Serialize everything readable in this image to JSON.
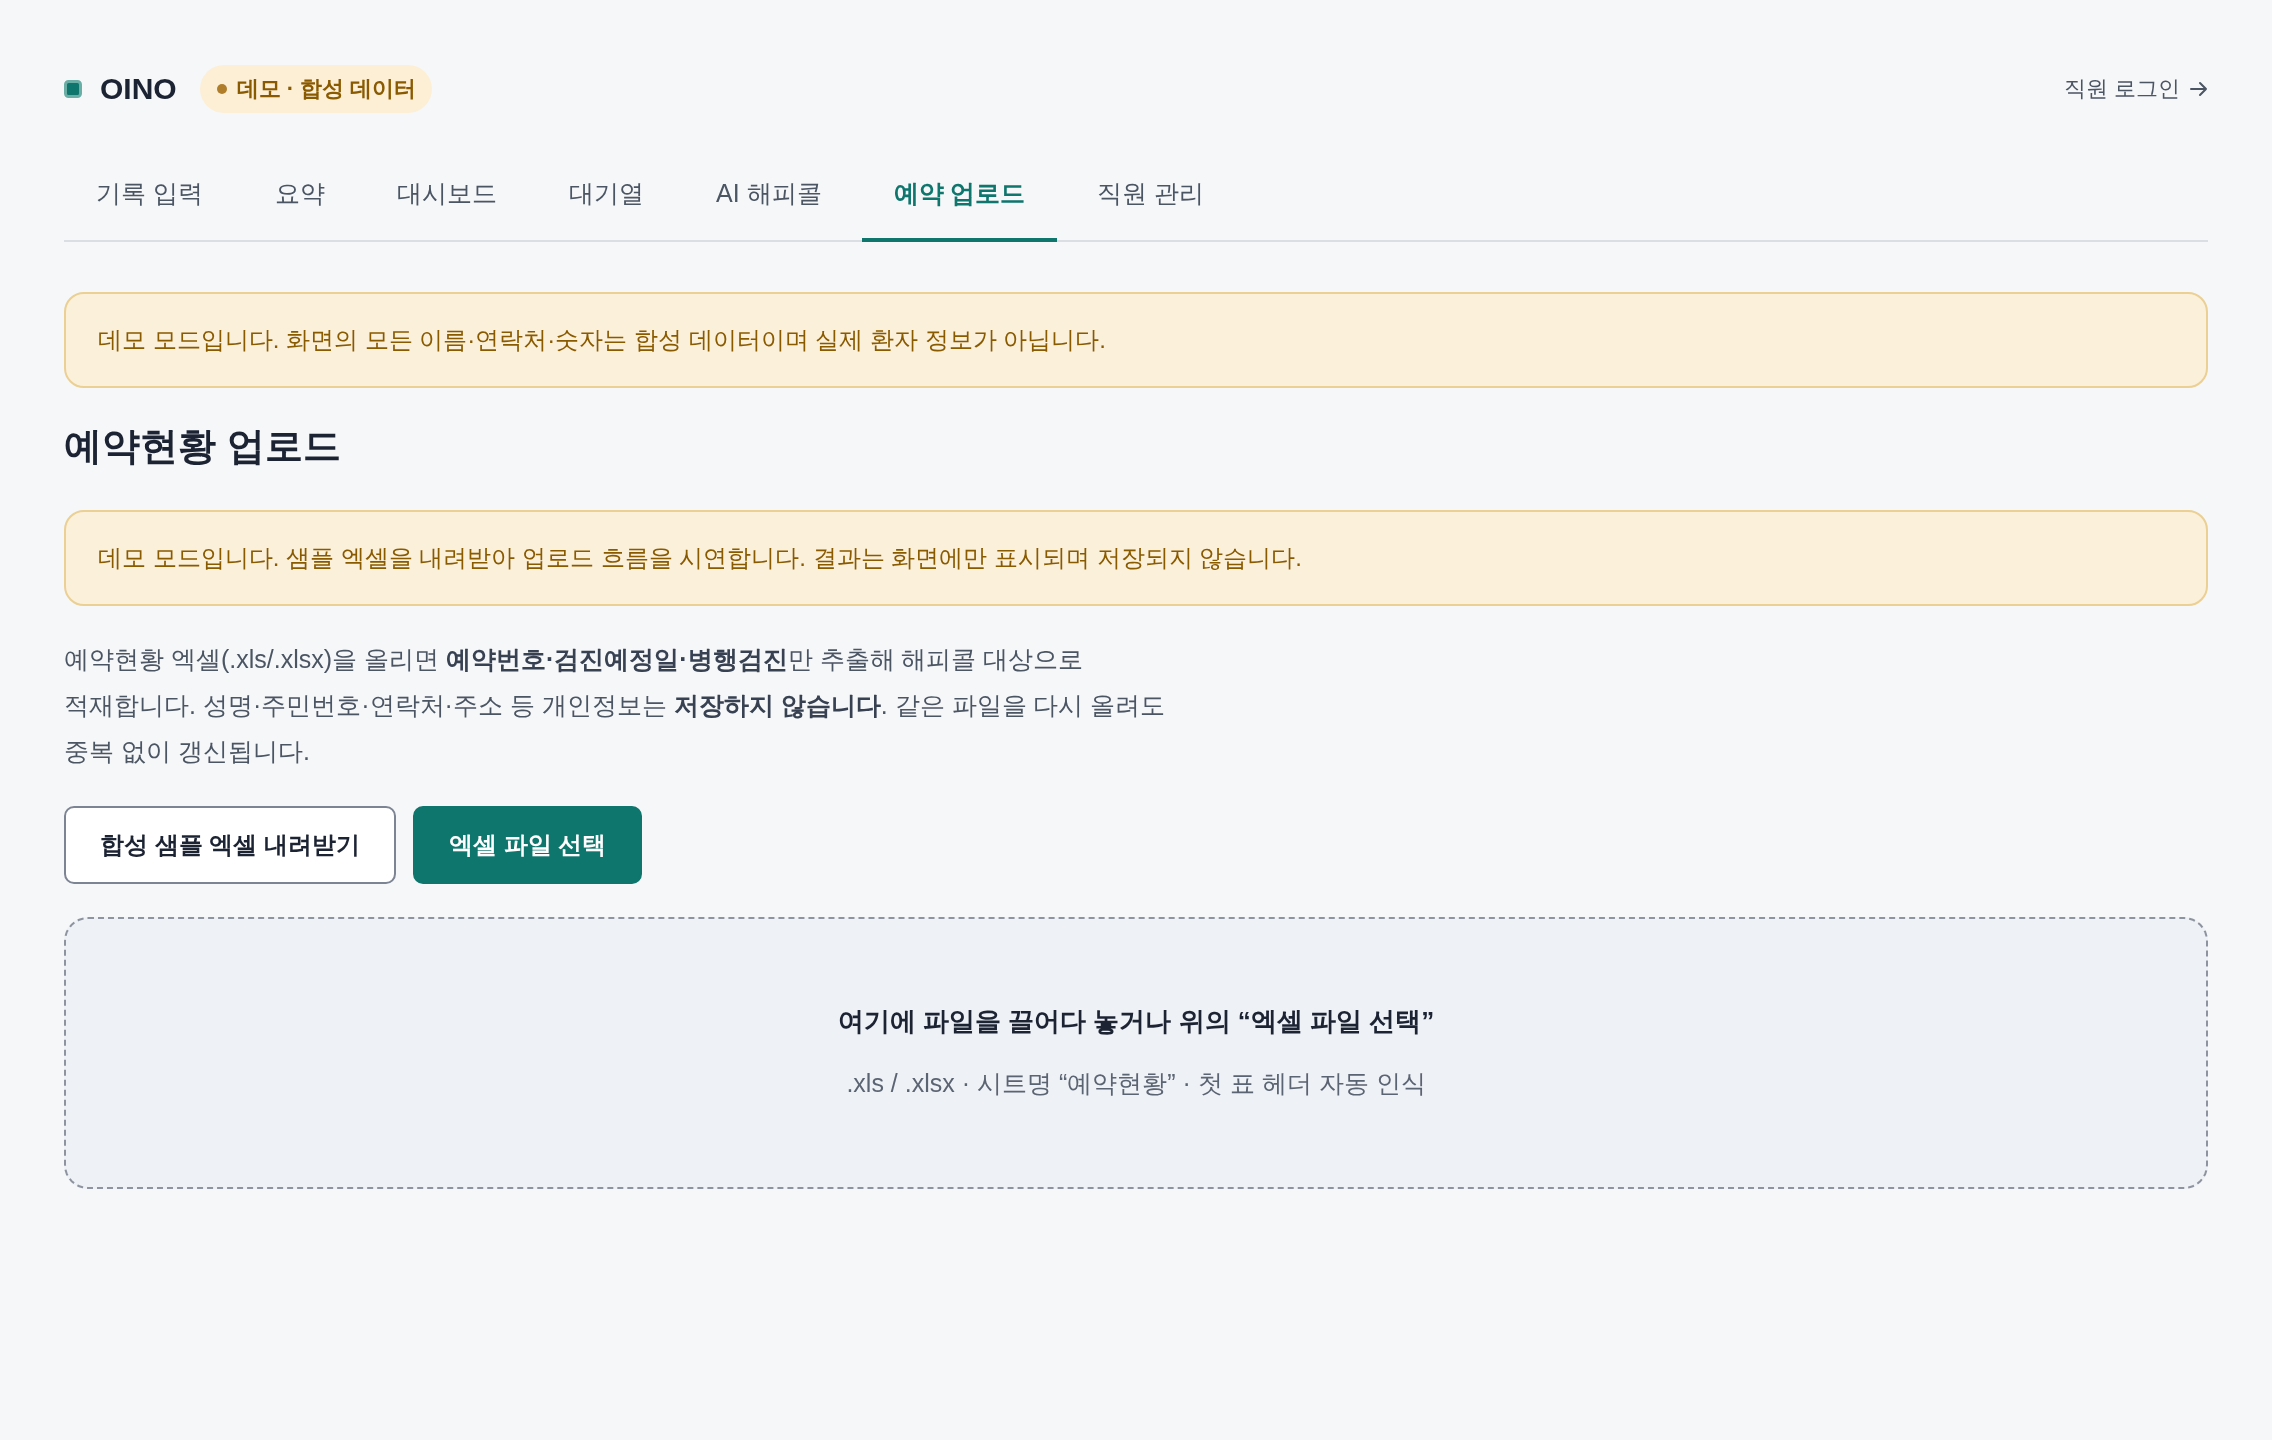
{
  "header": {
    "brand": "OINO",
    "mode_badge": "데모 · 합성 데이터",
    "login_link": "직원 로그인"
  },
  "tabs": [
    {
      "label": "기록 입력",
      "selected": false
    },
    {
      "label": "요약",
      "selected": false
    },
    {
      "label": "대시보드",
      "selected": false
    },
    {
      "label": "대기열",
      "selected": false
    },
    {
      "label": "AI 해피콜",
      "selected": false
    },
    {
      "label": "예약 업로드",
      "selected": true
    },
    {
      "label": "직원 관리",
      "selected": false
    }
  ],
  "demo_notice": "데모 모드입니다. 화면의 모든 이름·연락처·숫자는 합성 데이터이며 실제 환자 정보가 아닙니다.",
  "page_title": "예약현황 업로드",
  "upload_notice": "데모 모드입니다. 샘플 엑셀을 내려받아 업로드 흐름을 시연합니다. 결과는 화면에만 표시되며 저장되지 않습니다.",
  "description": "예약현황 엑셀(.xls/.xlsx)을 올리면 **예약번호·검진예정일·병행검진**만 추출해 해피콜 대상으로 적재합니다. 성명·주민번호·연락처·주소 등 개인정보는 **저장하지 않습니다**. 같은 파일을 다시 올려도 중복 없이 갱신됩니다.",
  "buttons": [
    {
      "label": "합성 샘플 엑셀 내려받기",
      "kind": "secondary"
    },
    {
      "label": "엑셀 파일 선택",
      "kind": "primary"
    }
  ],
  "dropzone": {
    "title": "여기에 파일을 끌어다 놓거나 위의 “엑셀 파일 선택”",
    "hint": ".xls / .xlsx · 시트명 “예약현황” · 첫 표 헤더 자동 인식"
  }
}
